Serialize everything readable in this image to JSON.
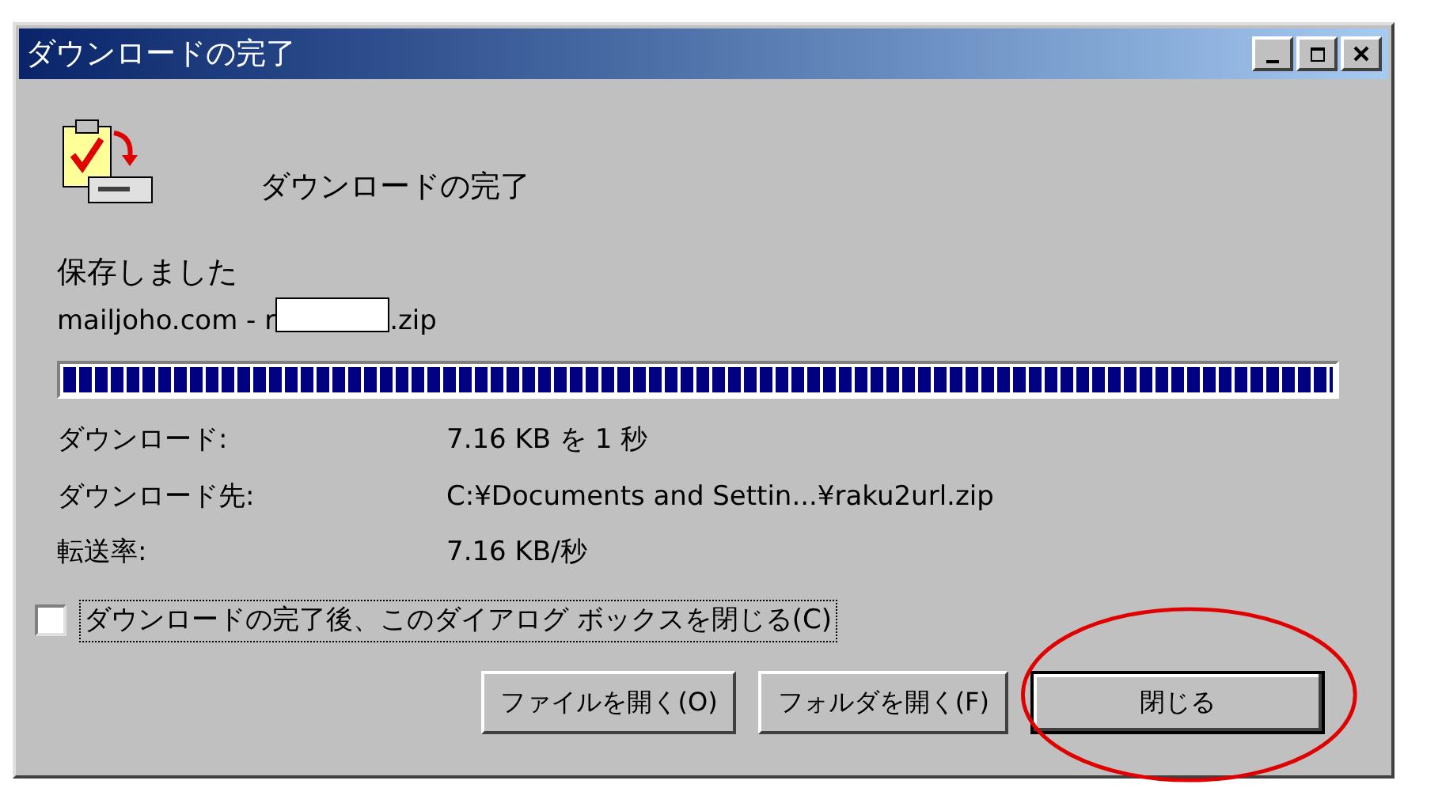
{
  "window": {
    "title": "ダウンロードの完了"
  },
  "heading": "ダウンロードの完了",
  "status": "保存しました",
  "file": {
    "name_start": "mailjoho.com - r",
    "name_end": ".zip",
    "redacted": true
  },
  "progress": {
    "level": 1
  },
  "details": [
    {
      "label": "ダウンロード:",
      "value": "7.16 KB を 1 秒"
    },
    {
      "label": "ダウンロード先:",
      "value": "C:¥Documents and Settin...¥raku2url.zip"
    },
    {
      "label": "転送率:",
      "value": "7.16 KB/秒"
    }
  ],
  "close_checkbox": {
    "label": "ダウンロードの完了後、このダイアログ ボックスを閉じる(C)",
    "checked": false
  },
  "buttons": [
    {
      "label": "ファイルを開く(O)",
      "highlighted": false
    },
    {
      "label": "フォルダを開く(F)",
      "highlighted": false
    },
    {
      "label": "閉じる",
      "highlighted": true
    }
  ]
}
